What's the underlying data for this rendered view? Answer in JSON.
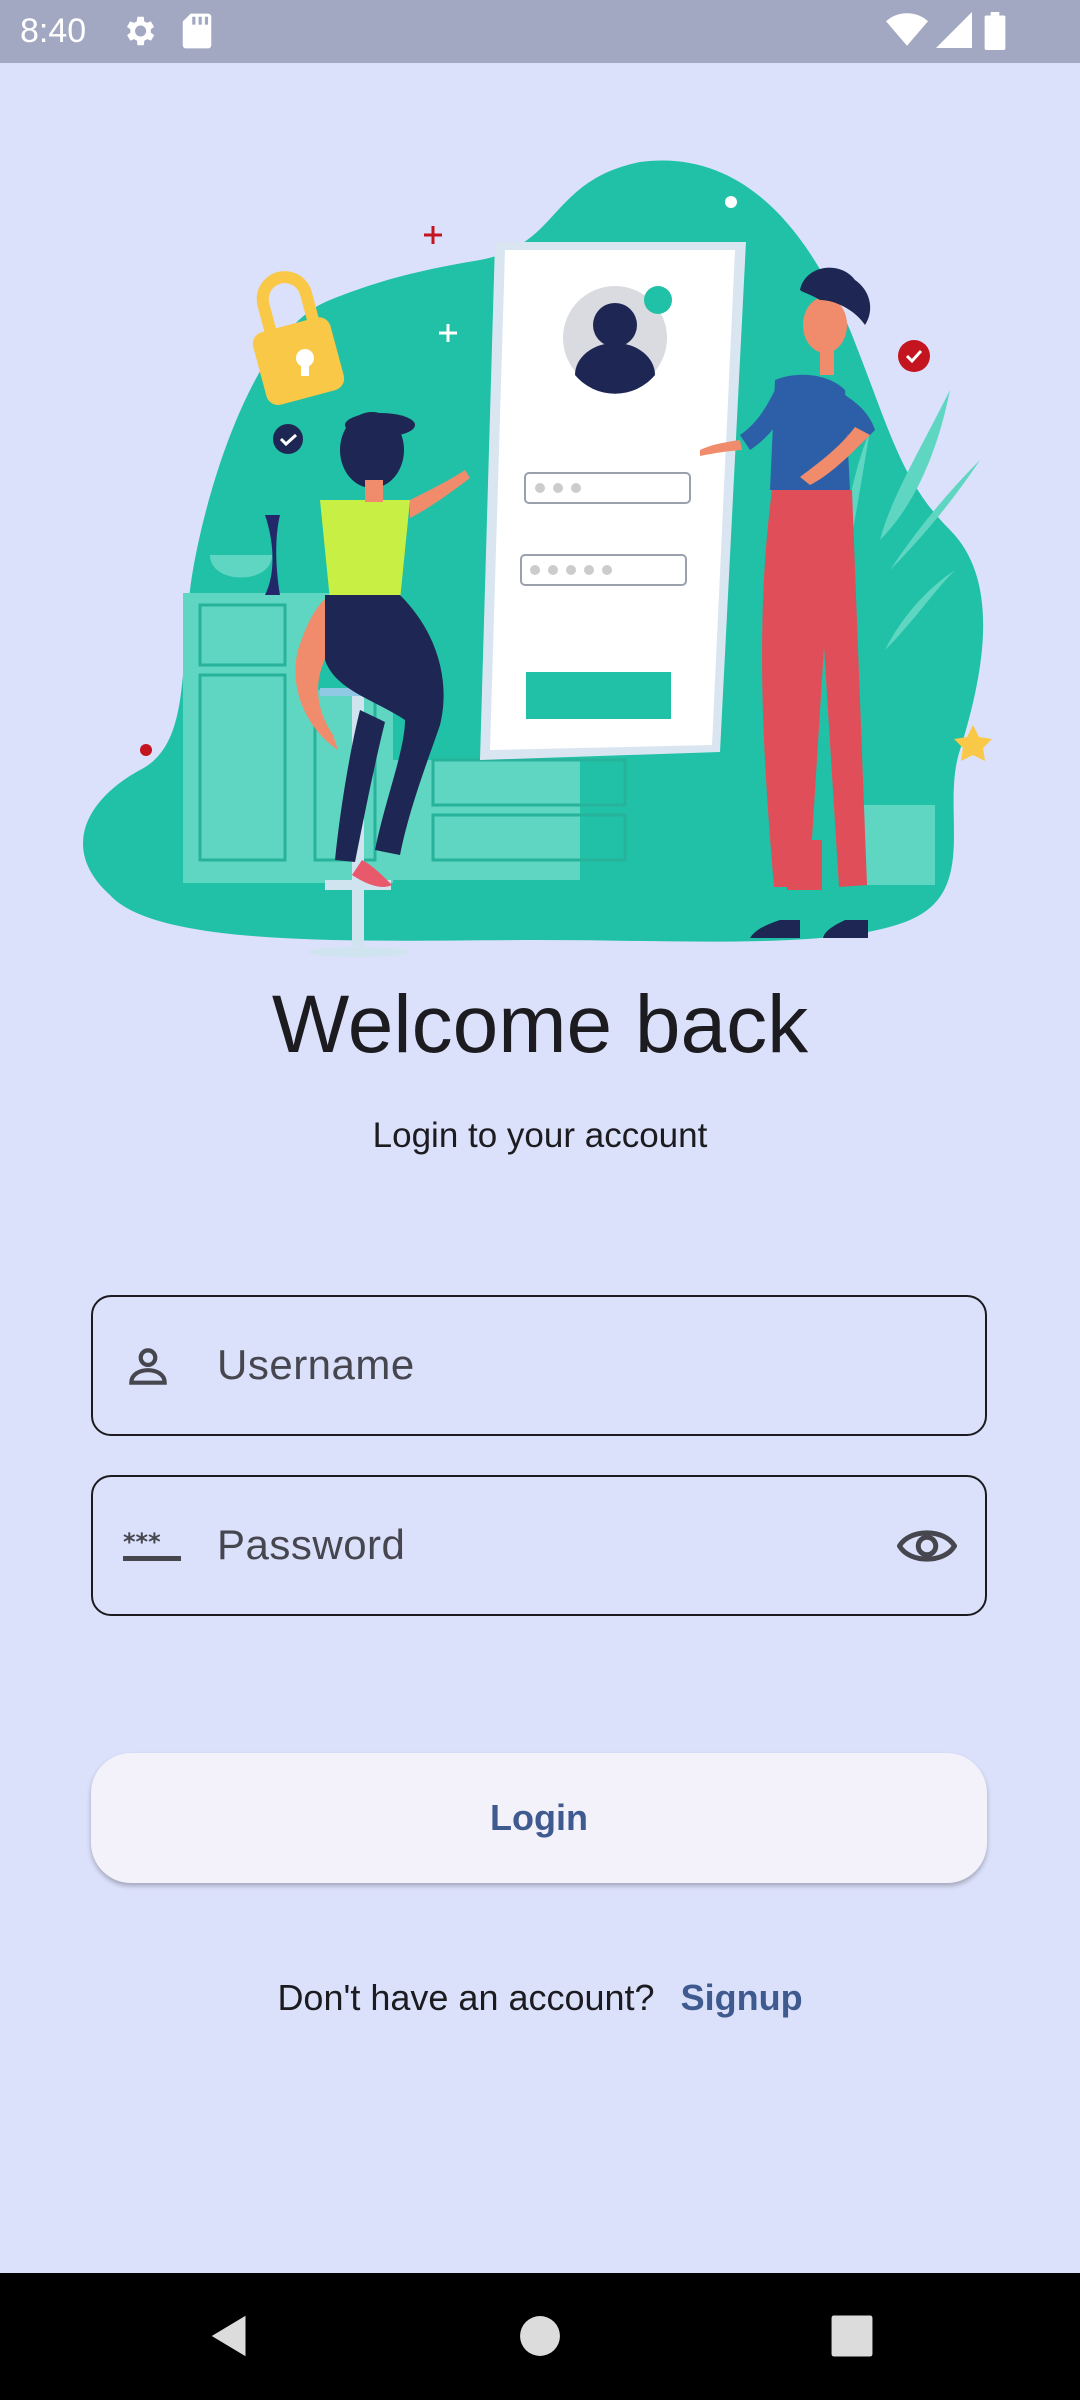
{
  "status_bar": {
    "time": "8:40",
    "icons": [
      "gear-icon",
      "sd-card-icon",
      "wifi-icon",
      "signal-icon",
      "battery-icon"
    ]
  },
  "illustration": {
    "name": "login-illustration"
  },
  "header": {
    "title": "Welcome back",
    "subtitle": "Login to your account"
  },
  "form": {
    "username": {
      "placeholder": "Username",
      "icon": "person-icon"
    },
    "password": {
      "placeholder": "Password",
      "icon": "password-dots-icon",
      "toggle_icon": "eye-icon"
    },
    "login_label": "Login"
  },
  "footer": {
    "question": "Don't have an account?",
    "signup_label": "Signup"
  },
  "nav_bar": {
    "buttons": [
      "back-icon",
      "home-icon",
      "recents-icon"
    ]
  },
  "colors": {
    "background": "#dbe0fb",
    "accent": "#3f5a8f",
    "teal": "#20c1a6"
  }
}
